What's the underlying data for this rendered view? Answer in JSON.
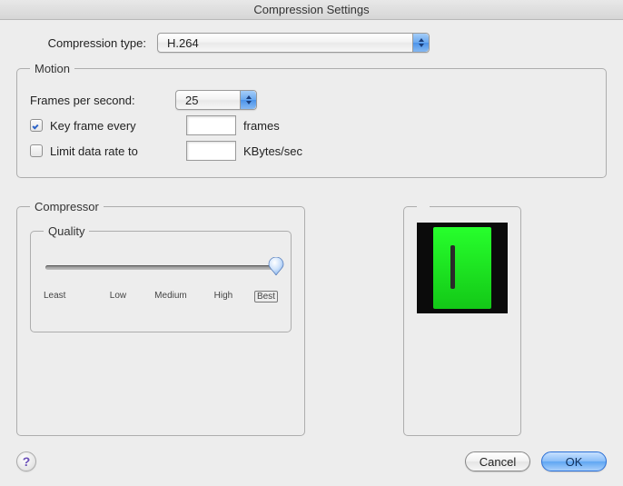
{
  "window": {
    "title": "Compression Settings"
  },
  "compression": {
    "type_label": "Compression type:",
    "type_value": "H.264"
  },
  "motion": {
    "legend": "Motion",
    "fps_label": "Frames per second:",
    "fps_value": "25",
    "keyframe_label": "Key frame every",
    "keyframe_value": "",
    "keyframe_suffix": "frames",
    "keyframe_checked": true,
    "datarate_label": "Limit data rate to",
    "datarate_value": "",
    "datarate_suffix": "KBytes/sec",
    "datarate_checked": false
  },
  "compressor": {
    "legend": "Compressor",
    "quality": {
      "legend": "Quality",
      "ticks": [
        "Least",
        "Low",
        "Medium",
        "High",
        "Best"
      ],
      "value_index": 4
    }
  },
  "buttons": {
    "help": "?",
    "cancel": "Cancel",
    "ok": "OK"
  }
}
